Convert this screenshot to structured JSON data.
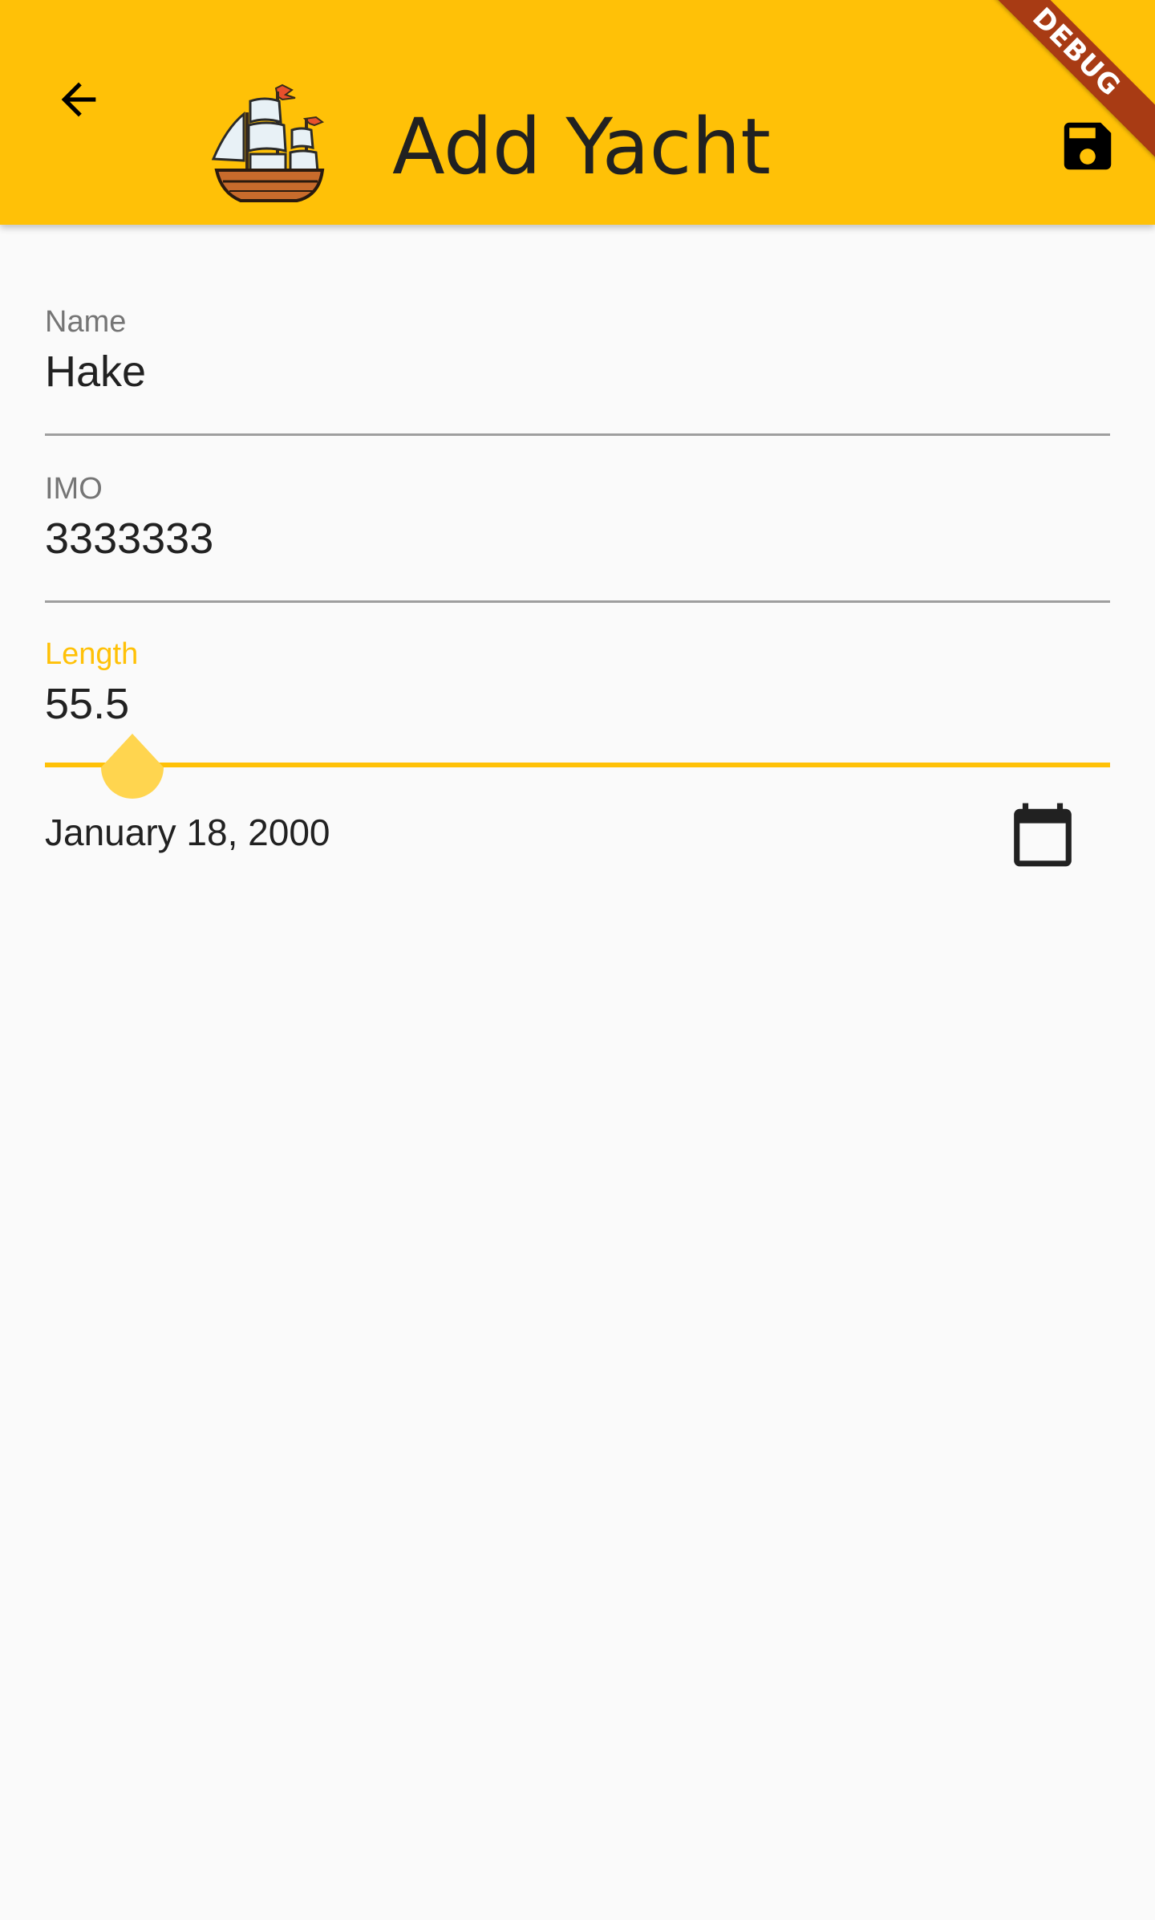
{
  "app_bar": {
    "title": "Add Yacht",
    "back_icon": "arrow-back-icon",
    "logo_icon": "sailing-ship-icon",
    "save_icon": "save-icon",
    "debug_banner": "DEBUG",
    "background_color": "#ffc107"
  },
  "form": {
    "name": {
      "label": "Name",
      "value": "Hake"
    },
    "imo": {
      "label": "IMO",
      "value": "3333333"
    },
    "length": {
      "label": "Length",
      "value": "55.5",
      "focused": true
    },
    "date": {
      "value": "January 18, 2000",
      "picker_icon": "calendar-icon"
    }
  },
  "colors": {
    "accent": "#ffc107",
    "text_primary": "#212121",
    "text_secondary": "#757575",
    "debug_ribbon": "#a83b14",
    "background": "#fafafa"
  }
}
